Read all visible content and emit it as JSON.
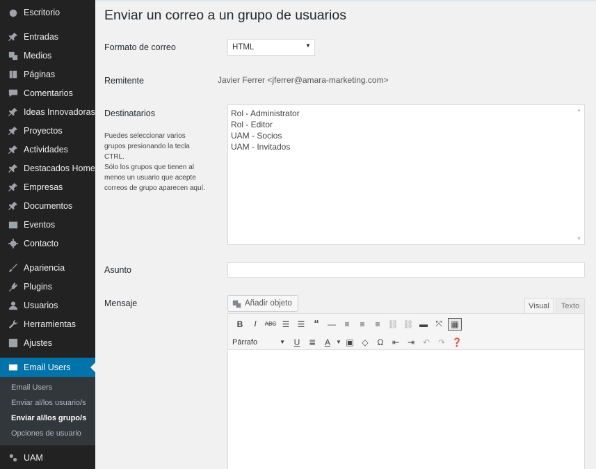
{
  "sidebar": {
    "items": [
      {
        "label": "Escritorio",
        "icon": "dashboard-icon"
      },
      {
        "label": "Entradas",
        "icon": "pin-icon"
      },
      {
        "label": "Medios",
        "icon": "media-icon"
      },
      {
        "label": "Páginas",
        "icon": "pages-icon"
      },
      {
        "label": "Comentarios",
        "icon": "comments-icon"
      },
      {
        "label": "Ideas Innovadoras",
        "icon": "pin-icon"
      },
      {
        "label": "Proyectos",
        "icon": "pin-icon"
      },
      {
        "label": "Actividades",
        "icon": "pin-icon"
      },
      {
        "label": "Destacados Home",
        "icon": "pin-icon"
      },
      {
        "label": "Empresas",
        "icon": "pin-icon"
      },
      {
        "label": "Documentos",
        "icon": "pin-icon"
      },
      {
        "label": "Eventos",
        "icon": "calendar-icon"
      },
      {
        "label": "Contacto",
        "icon": "gear-icon"
      },
      {
        "label": "Apariencia",
        "icon": "brush-icon"
      },
      {
        "label": "Plugins",
        "icon": "plugin-icon"
      },
      {
        "label": "Usuarios",
        "icon": "user-icon"
      },
      {
        "label": "Herramientas",
        "icon": "wrench-icon"
      },
      {
        "label": "Ajustes",
        "icon": "settings-icon"
      },
      {
        "label": "Email Users",
        "icon": "email-icon"
      },
      {
        "label": "UAM",
        "icon": "uam-icon"
      }
    ],
    "submenu": [
      "Email Users",
      "Enviar al/los usuario/s",
      "Enviar al/los grupo/s",
      "Opciones de usuario"
    ]
  },
  "page": {
    "title": "Enviar un correo a un grupo de usuarios",
    "format_label": "Formato de correo",
    "format_value": "HTML",
    "sender_label": "Remitente",
    "sender_value": "Javier Ferrer <jferrer@amara-marketing.com>",
    "recipients_label": "Destinatarios",
    "recipients_help_1": "Puedes seleccionar varios grupos presionando la tecla CTRL.",
    "recipients_help_2": "Sólo los grupos que tienen al menos un usuario que acepte correos de grupo aparecen aquí.",
    "recipients": [
      "Rol - Administrator",
      "Rol - Editor",
      "UAM - Socios",
      "UAM - Invitados"
    ],
    "subject_label": "Asunto",
    "subject_value": "",
    "message_label": "Mensaje",
    "add_media": "Añadir objeto",
    "tab_visual": "Visual",
    "tab_text": "Texto",
    "paragraph_format": "Párrafo"
  }
}
